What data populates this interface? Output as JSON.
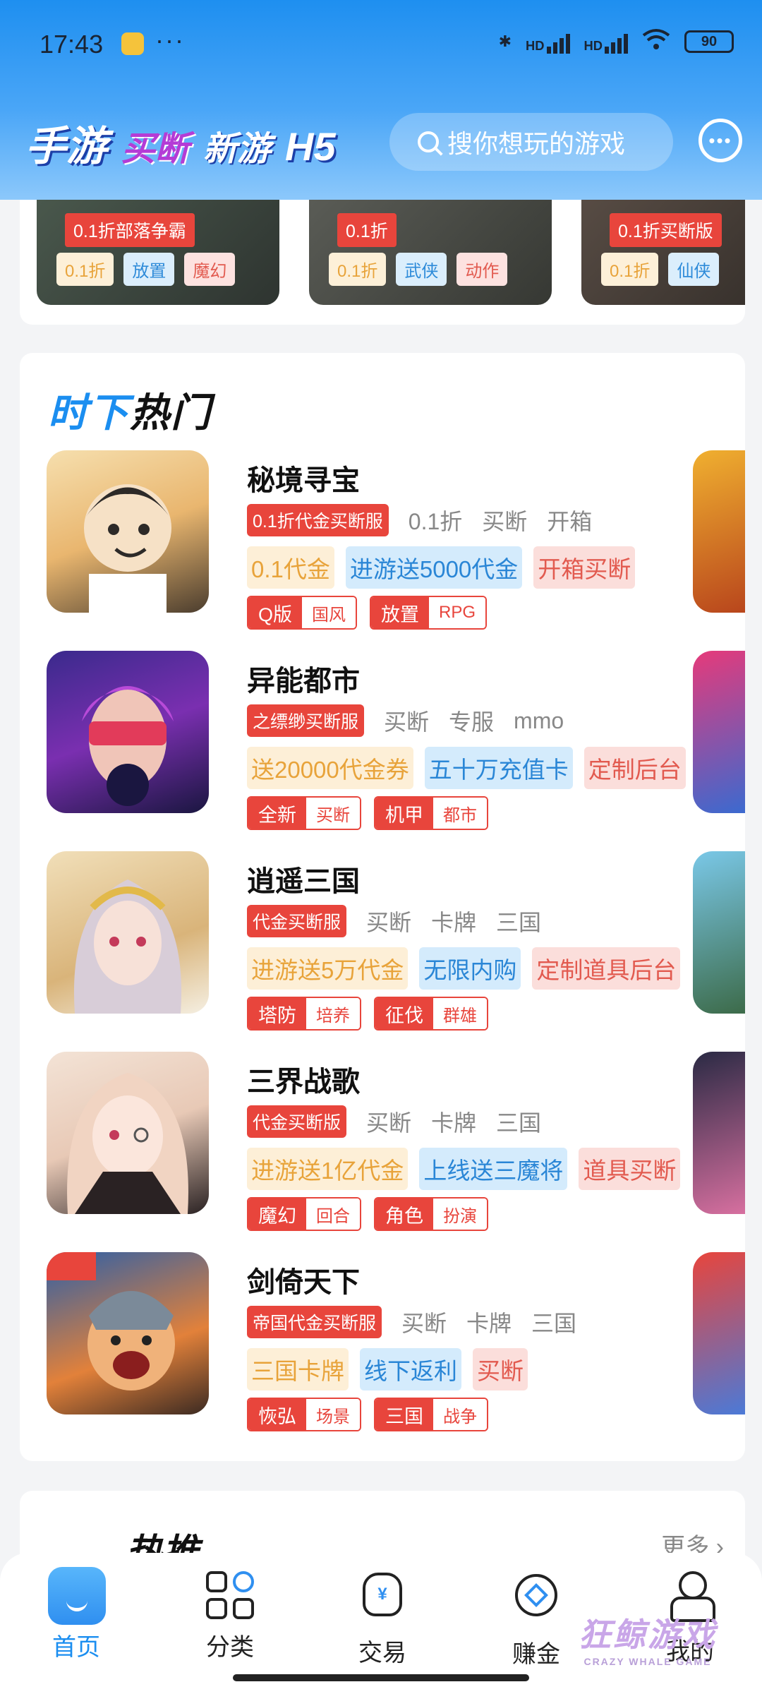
{
  "status_bar": {
    "time": "17:43",
    "more": "···",
    "hd1": "HD",
    "hd2": "HD",
    "battery": "90"
  },
  "header": {
    "logo_1": "手游",
    "logo_2": "买断",
    "logo_3": "新游",
    "logo_4": "H5",
    "search_placeholder": "搜你想玩的游戏",
    "message_icon": "message-bubble-icon"
  },
  "top_banners": [
    {
      "ribbon": "0.1折部落争霸",
      "tags": [
        "0.1折",
        "放置",
        "魔幻"
      ]
    },
    {
      "ribbon": "0.1折",
      "tags": [
        "0.1折",
        "武侠",
        "动作"
      ]
    },
    {
      "ribbon": "0.1折买断版",
      "tags": [
        "0.1折",
        "仙侠"
      ]
    }
  ],
  "hot": {
    "title_1": "时下",
    "title_2": "热门",
    "games": [
      {
        "name": "秘境寻宝",
        "badge": "0.1折代金买断服",
        "features": [
          "0.1折",
          "买断",
          "开箱"
        ],
        "promos": [
          "0.1代金",
          "进游送5000代金",
          "开箱买断"
        ],
        "categories": [
          [
            "Q版",
            "国风"
          ],
          [
            "放置",
            "RPG"
          ]
        ]
      },
      {
        "name": "异能都市",
        "badge": "之缥缈买断服",
        "features": [
          "买断",
          "专服",
          "mmo"
        ],
        "promos": [
          "送20000代金券",
          "五十万充值卡",
          "定制后台"
        ],
        "categories": [
          [
            "全新",
            "买断"
          ],
          [
            "机甲",
            "都市"
          ]
        ]
      },
      {
        "name": "逍遥三国",
        "badge": "代金买断服",
        "features": [
          "买断",
          "卡牌",
          "三国"
        ],
        "promos": [
          "进游送5万代金",
          "无限内购",
          "定制道具后台"
        ],
        "categories": [
          [
            "塔防",
            "培养"
          ],
          [
            "征伐",
            "群雄"
          ]
        ]
      },
      {
        "name": "三界战歌",
        "badge": "代金买断版",
        "features": [
          "买断",
          "卡牌",
          "三国"
        ],
        "promos": [
          "进游送1亿代金",
          "上线送三魔将",
          "道具买断"
        ],
        "categories": [
          [
            "魔幻",
            "回合"
          ],
          [
            "角色",
            "扮演"
          ]
        ]
      },
      {
        "name": "剑倚天下",
        "badge": "帝国代金买断服",
        "features": [
          "买断",
          "卡牌",
          "三国"
        ],
        "promos": [
          "三国卡牌",
          "线下返利",
          "买断"
        ],
        "categories": [
          [
            "恢弘",
            "场景"
          ],
          [
            "三国",
            "战争"
          ]
        ]
      }
    ]
  },
  "next_section": {
    "title": "热推",
    "more": "更多 ›"
  },
  "bottom_nav": [
    {
      "label": "首页",
      "icon": "home-icon"
    },
    {
      "label": "分类",
      "icon": "category-grid-icon"
    },
    {
      "label": "交易",
      "icon": "money-bag-icon"
    },
    {
      "label": "赚金",
      "icon": "coin-icon"
    },
    {
      "label": "我的",
      "icon": "user-icon"
    }
  ],
  "watermark": {
    "cn": "狂鲸游戏",
    "en": "CRAZY WHALE GAME"
  },
  "colors": {
    "primary": "#1b8ef0",
    "red": "#e8453c",
    "yellow_tag": "#e8a33a",
    "blue_tag": "#2a86d6"
  }
}
